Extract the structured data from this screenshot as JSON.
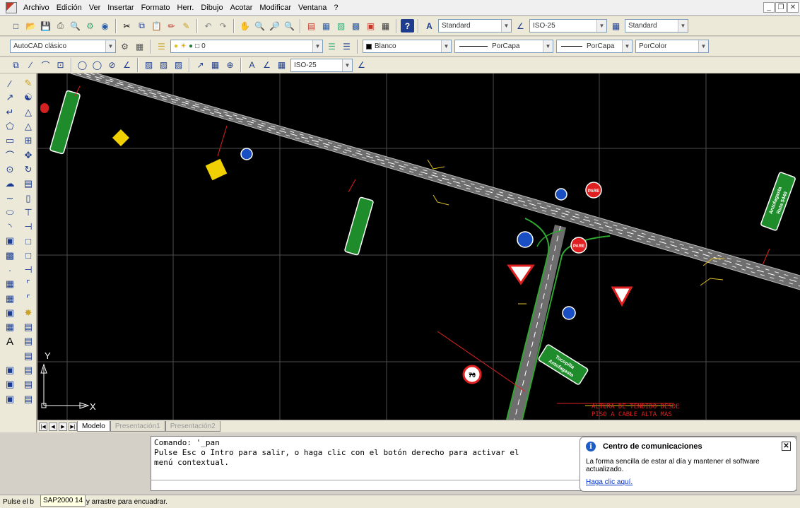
{
  "menubar": {
    "items": [
      "Archivo",
      "Edición",
      "Ver",
      "Insertar",
      "Formato",
      "Herr.",
      "Dibujo",
      "Acotar",
      "Modificar",
      "Ventana",
      "?"
    ]
  },
  "toolbar_std": {
    "text_style": "Standard",
    "dim_style": "ISO-25",
    "table_style": "Standard"
  },
  "toolbar_layers": {
    "workspace": "AutoCAD clásico",
    "layer": "0",
    "color": "Blanco",
    "linetype": "PorCapa",
    "lineweight": "PorCapa",
    "plotstyle": "PorColor"
  },
  "toolbar_dim": {
    "dim_style": "ISO-25"
  },
  "drawing": {
    "ucs_y": "Y",
    "ucs_x": "X",
    "note_line1": "ALTURA DE TENDIDO DESDE",
    "note_line2": "PISO A CABLE ALTA MAS",
    "sign_pare": "PARE",
    "sign_ant_lines": [
      "Antofagasta",
      "Ruta 5440"
    ],
    "sign_green_lines": [
      "Tocopilla",
      "Antofagasta"
    ],
    "sign_speed": "70"
  },
  "layout_tabs": [
    {
      "label": "Modelo",
      "active": true
    },
    {
      "label": "Presentación1",
      "active": false
    },
    {
      "label": "Presentación2",
      "active": false
    }
  ],
  "command": {
    "line1": "Comando: '_pan",
    "line2": "Pulse Esc o Intro para salir, o haga clic con el botón derecho para activar el",
    "line3": "menú contextual."
  },
  "status": {
    "text_before": "Pulse el b",
    "text_after": "ón y arrastre para encuadrar.",
    "tooltip": "SAP2000 14"
  },
  "balloon": {
    "title": "Centro de comunicaciones",
    "message": "La forma sencilla de estar al día y mantener el software actualizado.",
    "link": "Haga clic aquí."
  }
}
